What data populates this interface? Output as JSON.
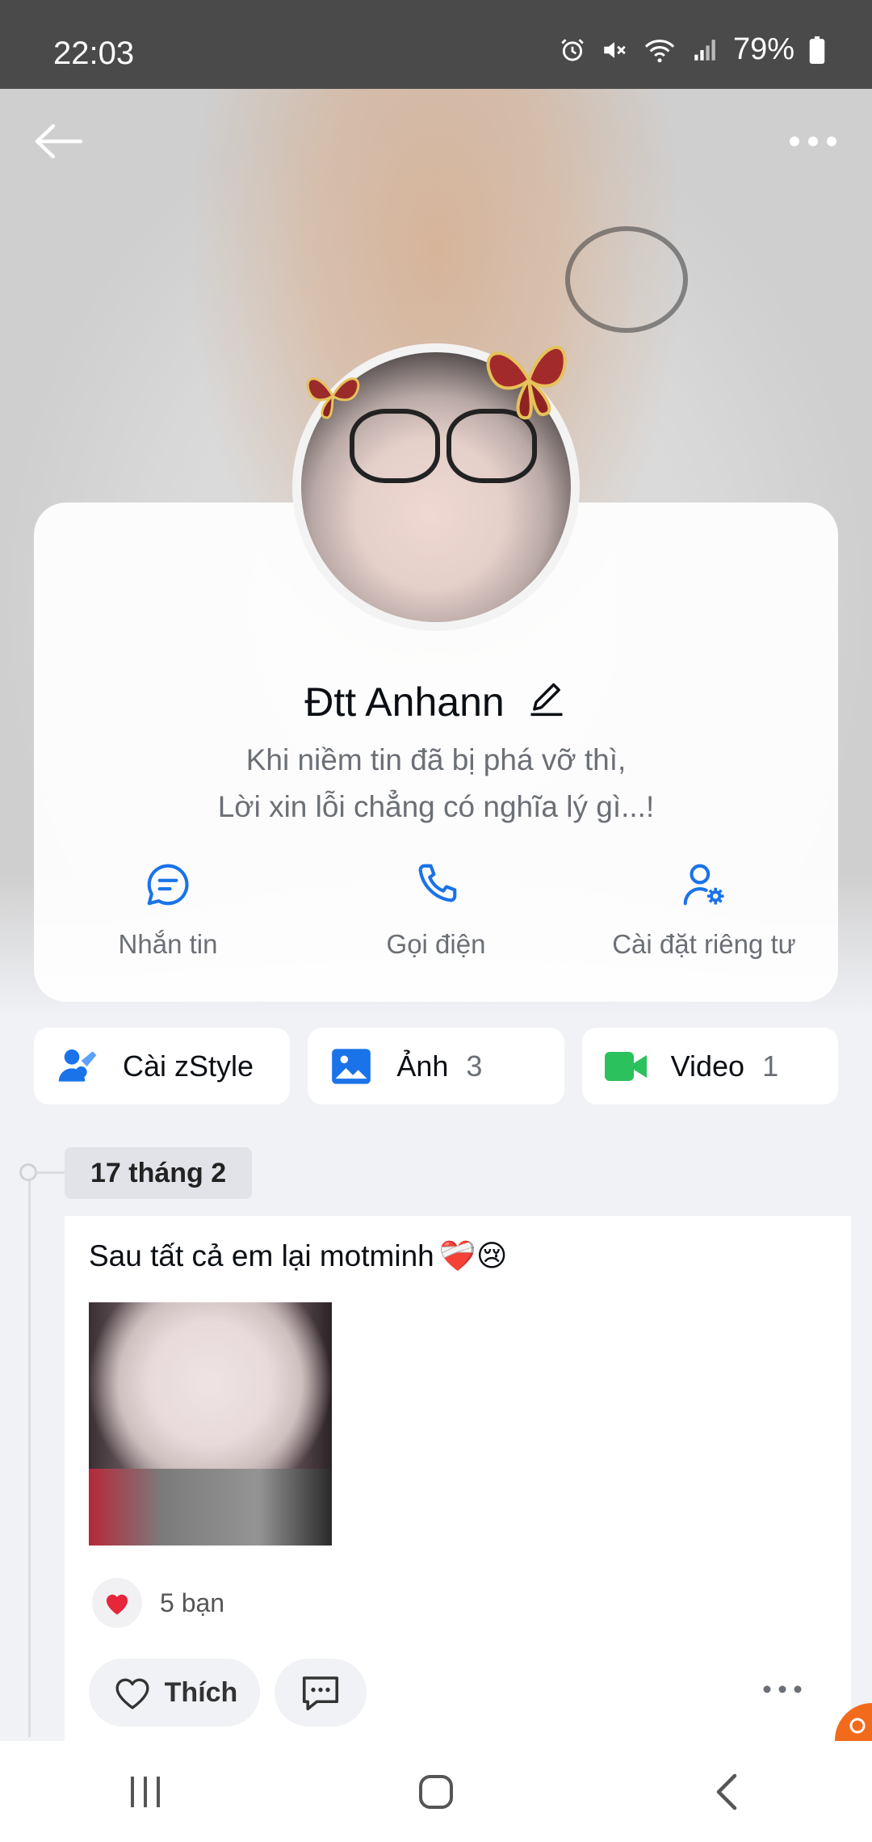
{
  "status_bar": {
    "time": "22:03",
    "battery": "79%",
    "icons": [
      "alarm-icon",
      "mute-icon",
      "wifi-icon",
      "signal-icon",
      "battery-icon"
    ]
  },
  "profile": {
    "name": "Đtt Anhann",
    "bio_line1": "Khi niềm tin đã bị phá vỡ thì,",
    "bio_line2": "Lời xin lỗi chẳng có nghĩa lý gì...!"
  },
  "actions": {
    "message": "Nhắn tin",
    "call": "Gọi điện",
    "privacy": "Cài đặt riêng tư"
  },
  "quick": {
    "zstyle": "Cài zStyle",
    "photos": "Ảnh",
    "photos_count": "3",
    "video": "Video",
    "video_count": "1"
  },
  "timeline": {
    "date": "17 tháng 2",
    "post_text": "Sau tất cả em lại motminh",
    "post_emojis": "❤️‍🩹😢",
    "likes": "5 bạn",
    "like_label": "Thích"
  },
  "colors": {
    "accent": "#1a73e8",
    "video_green": "#2bc15c",
    "status_bar_bg": "#4a4a4a"
  }
}
